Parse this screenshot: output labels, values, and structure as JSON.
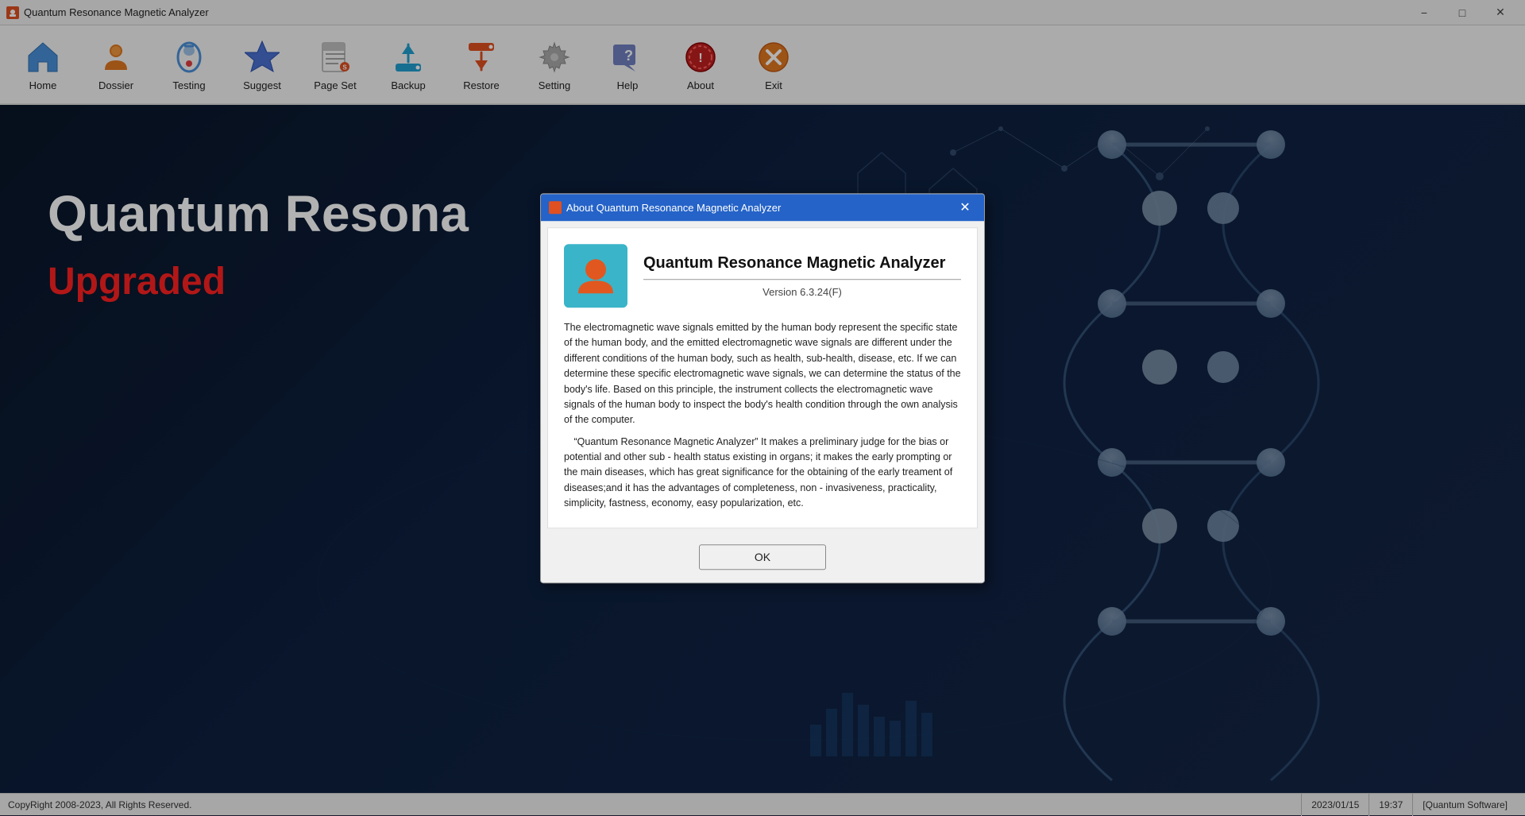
{
  "window": {
    "title": "Quantum Resonance Magnetic Analyzer"
  },
  "titlebar": {
    "title": "Quantum Resonance Magnetic Analyzer",
    "minimize": "−",
    "maximize": "□",
    "close": "✕"
  },
  "toolbar": {
    "items": [
      {
        "id": "home",
        "label": "Home"
      },
      {
        "id": "dossier",
        "label": "Dossier"
      },
      {
        "id": "testing",
        "label": "Testing"
      },
      {
        "id": "suggest",
        "label": "Suggest"
      },
      {
        "id": "page-set",
        "label": "Page Set"
      },
      {
        "id": "backup",
        "label": "Backup"
      },
      {
        "id": "restore",
        "label": "Restore"
      },
      {
        "id": "setting",
        "label": "Setting"
      },
      {
        "id": "help",
        "label": "Help"
      },
      {
        "id": "about",
        "label": "About"
      },
      {
        "id": "exit",
        "label": "Exit"
      }
    ]
  },
  "main": {
    "title_partial": "Quantum Resona",
    "upgraded_label": "Upgraded"
  },
  "modal": {
    "titlebar_text": "About Quantum Resonance Magnetic Analyzer",
    "app_title": "Quantum Resonance Magnetic Analyzer",
    "version": "Version 6.3.24(F)",
    "body_paragraph1": "The electromagnetic wave signals emitted by the human body represent the specific state of the human body, and the emitted electromagnetic wave signals are different under the different conditions of the human body, such as health, sub-health, disease, etc. If we can determine these specific electromagnetic wave signals, we can determine the status of the body's life. Based on this principle, the instrument collects the electromagnetic wave signals of the human body to inspect the body's health condition through the own analysis of the computer.",
    "body_paragraph2": "“Quantum Resonance Magnetic Analyzer” It makes a preliminary judge for the bias or potential and other sub - health status existing in organs; it makes the early prompting or the main diseases, which has great significance for the obtaining of the early treament of diseases;and it has the advantages of completeness, non - invasiveness, practicality, simplicity, fastness, economy, easy popularization, etc.",
    "ok_button": "OK"
  },
  "statusbar": {
    "copyright": "CopyRight 2008-2023, All Rights Reserved.",
    "date": "2023/01/15",
    "time": "19:37",
    "software": "[Quantum Software]"
  }
}
